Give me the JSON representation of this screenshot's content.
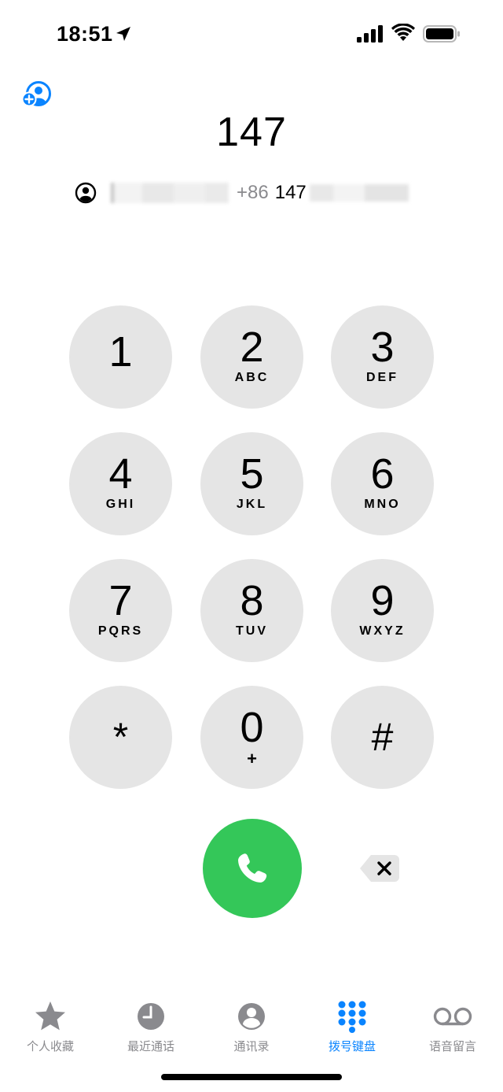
{
  "status_bar": {
    "time": "18:51"
  },
  "dialer": {
    "entered_number": "147",
    "suggestion": {
      "country_code": "+86",
      "number_prefix": "147"
    }
  },
  "keypad": [
    {
      "digit": "1",
      "letters": ""
    },
    {
      "digit": "2",
      "letters": "ABC"
    },
    {
      "digit": "3",
      "letters": "DEF"
    },
    {
      "digit": "4",
      "letters": "GHI"
    },
    {
      "digit": "5",
      "letters": "JKL"
    },
    {
      "digit": "6",
      "letters": "MNO"
    },
    {
      "digit": "7",
      "letters": "PQRS"
    },
    {
      "digit": "8",
      "letters": "TUV"
    },
    {
      "digit": "9",
      "letters": "WXYZ"
    },
    {
      "digit": "*",
      "letters": ""
    },
    {
      "digit": "0",
      "letters": "+"
    },
    {
      "digit": "#",
      "letters": ""
    }
  ],
  "tabs": [
    {
      "label": "个人收藏",
      "icon": "star-icon"
    },
    {
      "label": "最近通话",
      "icon": "clock-icon"
    },
    {
      "label": "通讯录",
      "icon": "contacts-icon"
    },
    {
      "label": "拨号键盘",
      "icon": "keypad-icon",
      "active": true
    },
    {
      "label": "语音留言",
      "icon": "voicemail-icon"
    }
  ],
  "colors": {
    "accent": "#0a84ff",
    "call_green": "#34c759",
    "key_bg": "#e5e5e5",
    "tab_inactive": "#8a8a8e"
  }
}
